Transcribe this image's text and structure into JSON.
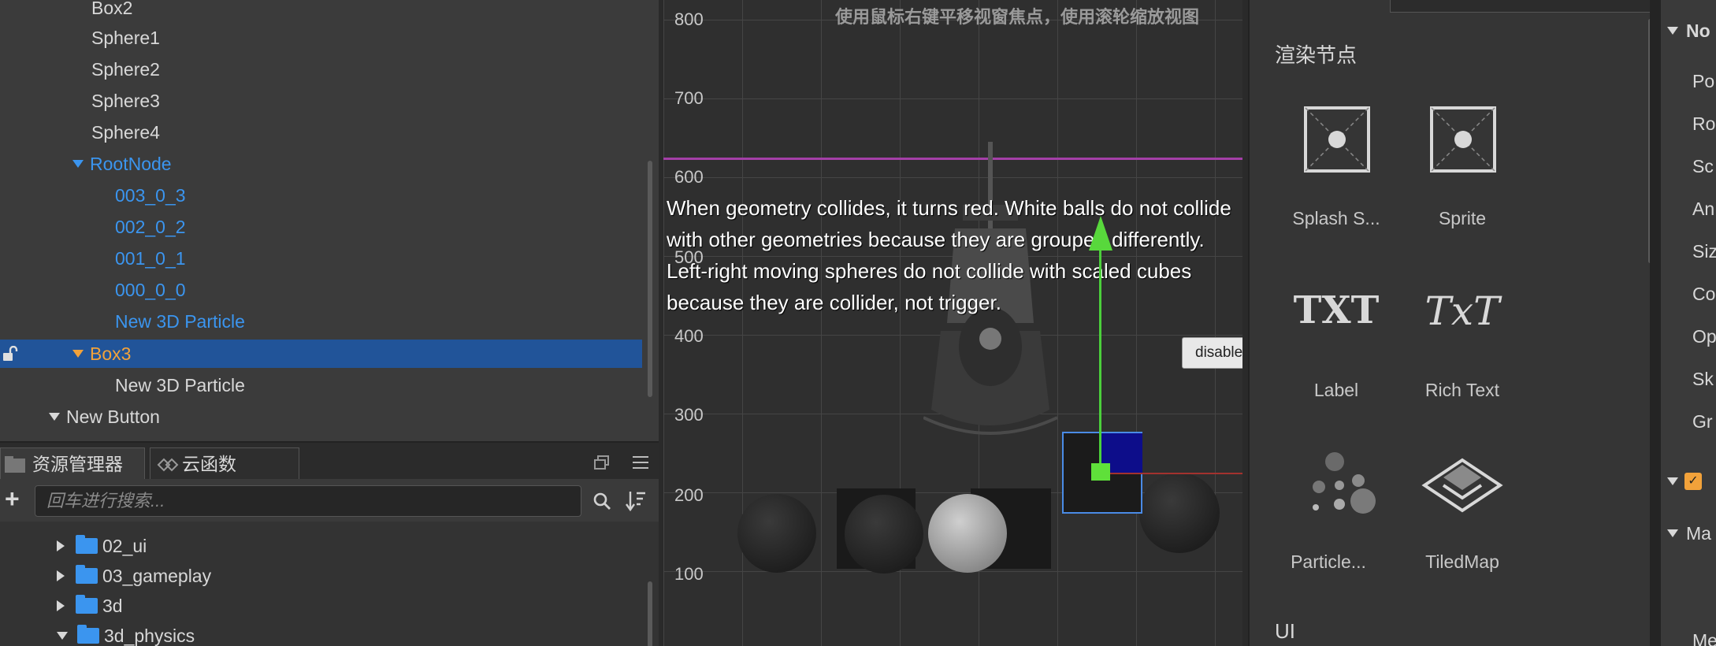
{
  "hierarchy": {
    "rows": [
      {
        "label": "Box2"
      },
      {
        "label": "Sphere1"
      },
      {
        "label": "Sphere2"
      },
      {
        "label": "Sphere3"
      },
      {
        "label": "Sphere4"
      },
      {
        "label": "RootNode"
      },
      {
        "label": "003_0_3"
      },
      {
        "label": "002_0_2"
      },
      {
        "label": "001_0_1"
      },
      {
        "label": "000_0_0"
      },
      {
        "label": "New 3D Particle"
      },
      {
        "label": "Box3"
      },
      {
        "label": "New 3D Particle"
      },
      {
        "label": "New Button"
      }
    ]
  },
  "assets": {
    "tabs": [
      "资源管理器",
      "云函数"
    ],
    "search_placeholder": "回车进行搜索...",
    "folders": [
      {
        "label": "02_ui"
      },
      {
        "label": "03_gameplay"
      },
      {
        "label": "3d"
      },
      {
        "label": "3d_physics"
      }
    ]
  },
  "scene": {
    "hint": "使用鼠标右键平移视窗焦点，使用滚轮缩放视图",
    "y_labels": [
      "800",
      "700",
      "600",
      "500",
      "400",
      "300",
      "200",
      "100"
    ],
    "overlay_text": "When geometry collides, it turns red. White balls do not collide\nwith other geometries because they are grouped differently.\nLeft-right moving spheres do not collide with scaled cubes\nbecause they are collider, not trigger.",
    "button_label": "disable",
    "colors": {
      "highlight_line": "#a43fa8",
      "gizmo_up": "#58d83c",
      "gizmo_right": "#a3322e",
      "selection": "#4a8be6"
    }
  },
  "node_library": {
    "heading": "渲染节点",
    "items": [
      {
        "label": "Splash S...",
        "icon": "splash-screen-icon"
      },
      {
        "label": "Sprite",
        "icon": "sprite-icon"
      },
      {
        "label": "Label",
        "icon": "label-txt-icon",
        "glyph": "TXT"
      },
      {
        "label": "Rich Text",
        "icon": "rich-text-icon",
        "glyph": "TxT"
      },
      {
        "label": "Particle...",
        "icon": "particle-icon"
      },
      {
        "label": "TiledMap",
        "icon": "tiledmap-icon"
      }
    ],
    "section2": "UI"
  },
  "inspector": {
    "node_section": "No",
    "props": [
      "Po",
      "Ro",
      "Sc",
      "An",
      "Siz",
      "Co",
      "Op",
      "Sk",
      "Gr"
    ],
    "material_section": "Ma",
    "last_row": "Me"
  }
}
